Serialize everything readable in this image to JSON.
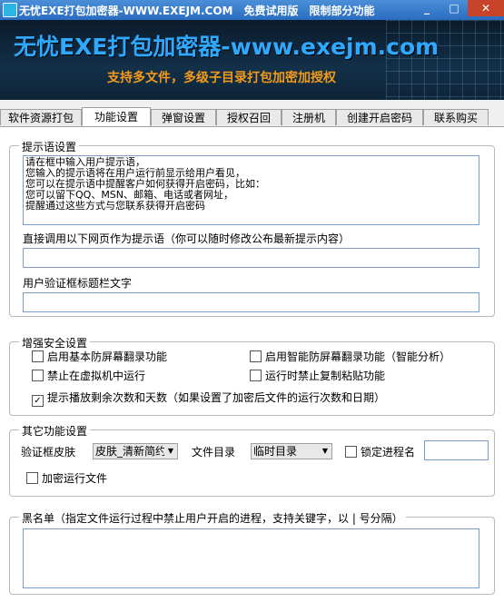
{
  "window": {
    "title": "无忧EXE打包加密器-WWW.EXEJM.COM　免费试用版　限制部分功能",
    "minimize": "_",
    "maximize": "□",
    "close": "✕"
  },
  "banner": {
    "title": "无忧EXE打包加密器-www.exejm.com",
    "subtitle": "支持多文件，多级子目录打包加密加授权"
  },
  "tabs": [
    {
      "label": "软件资源打包"
    },
    {
      "label": "功能设置"
    },
    {
      "label": "弹窗设置"
    },
    {
      "label": "授权召回"
    },
    {
      "label": "注册机"
    },
    {
      "label": "创建开启密码"
    },
    {
      "label": "联系购买"
    }
  ],
  "prompt_group": {
    "title": "提示语设置",
    "prompt_text": "请在框中输入用户提示语，\n您输入的提示语将在用户运行前显示给用户看见，\n您可以在提示语中提醒客户如何获得开启密码，比如：\n您可以留下QQ、MSN、邮箱、电话或者网址，\n提醒通过这些方式与您联系获得开启密码",
    "web_label": "直接调用以下网页作为提示语（你可以随时修改公布最新提示内容）",
    "web_value": "",
    "caption_label": "用户验证框标题栏文字",
    "caption_value": ""
  },
  "security_group": {
    "title": "增强安全设置",
    "options": [
      {
        "label": "启用基本防屏幕翻录功能",
        "checked": false
      },
      {
        "label": "启用智能防屏幕翻录功能（智能分析）",
        "checked": false
      },
      {
        "label": "禁止在虚拟机中运行",
        "checked": false
      },
      {
        "label": "运行时禁止复制粘贴功能",
        "checked": false
      },
      {
        "label": "提示播放剩余次数和天数（如果设置了加密后文件的运行次数和日期）",
        "checked": true
      }
    ]
  },
  "other_group": {
    "title": "其它功能设置",
    "skin_label": "验证框皮肤",
    "skin_value": "皮肤_清新简约",
    "dir_label": "文件目录",
    "dir_value": "临时目录",
    "lock_label": "锁定进程名",
    "lock_value": "",
    "encrypt_run_label": "加密运行文件"
  },
  "blacklist_group": {
    "title": "黑名单（指定文件运行过程中禁止用户开启的进程，支持关键字，以 | 号分隔）",
    "value": ""
  }
}
